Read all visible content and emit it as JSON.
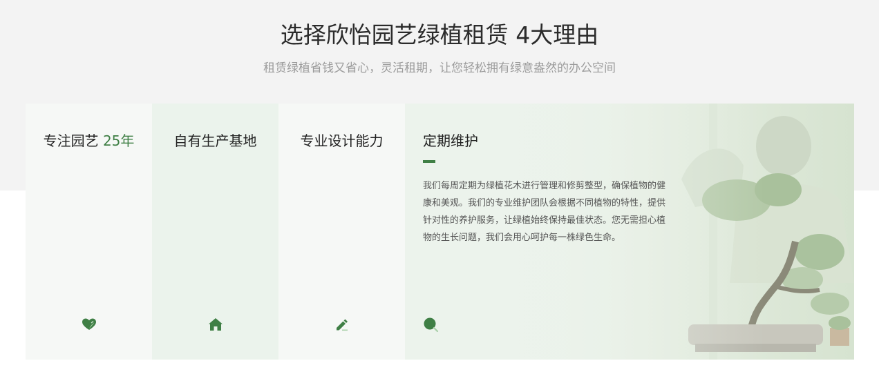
{
  "header": {
    "title": "选择欣怡园艺绿植租赁 4大理由",
    "subtitle": "租赁绿植省钱又省心，灵活租期，让您轻松拥有绿意盎然的办公空间"
  },
  "reasons": [
    {
      "title": "专注园艺 ",
      "title_number": "25年",
      "icon": "heart-leaf-icon"
    },
    {
      "title": "自有生产基地",
      "icon": "home-icon"
    },
    {
      "title": "专业设计能力",
      "icon": "pencil-icon"
    },
    {
      "title": "定期维护",
      "description": "我们每周定期为绿植花木进行管理和修剪整型，确保植物的健康和美观。我们的专业维护团队会根据不同植物的特性，提供针对性的养护服务，让绿植始终保持最佳状态。您无需担心植物的生长问题，我们会用心呵护每一株绿色生命。",
      "icon": "search-icon",
      "active": true
    }
  ],
  "colors": {
    "accent": "#3f7f45",
    "top_band": "#f3f3f3",
    "card_light": "#f6f8f6",
    "card_tint": "#ebf3ec"
  }
}
